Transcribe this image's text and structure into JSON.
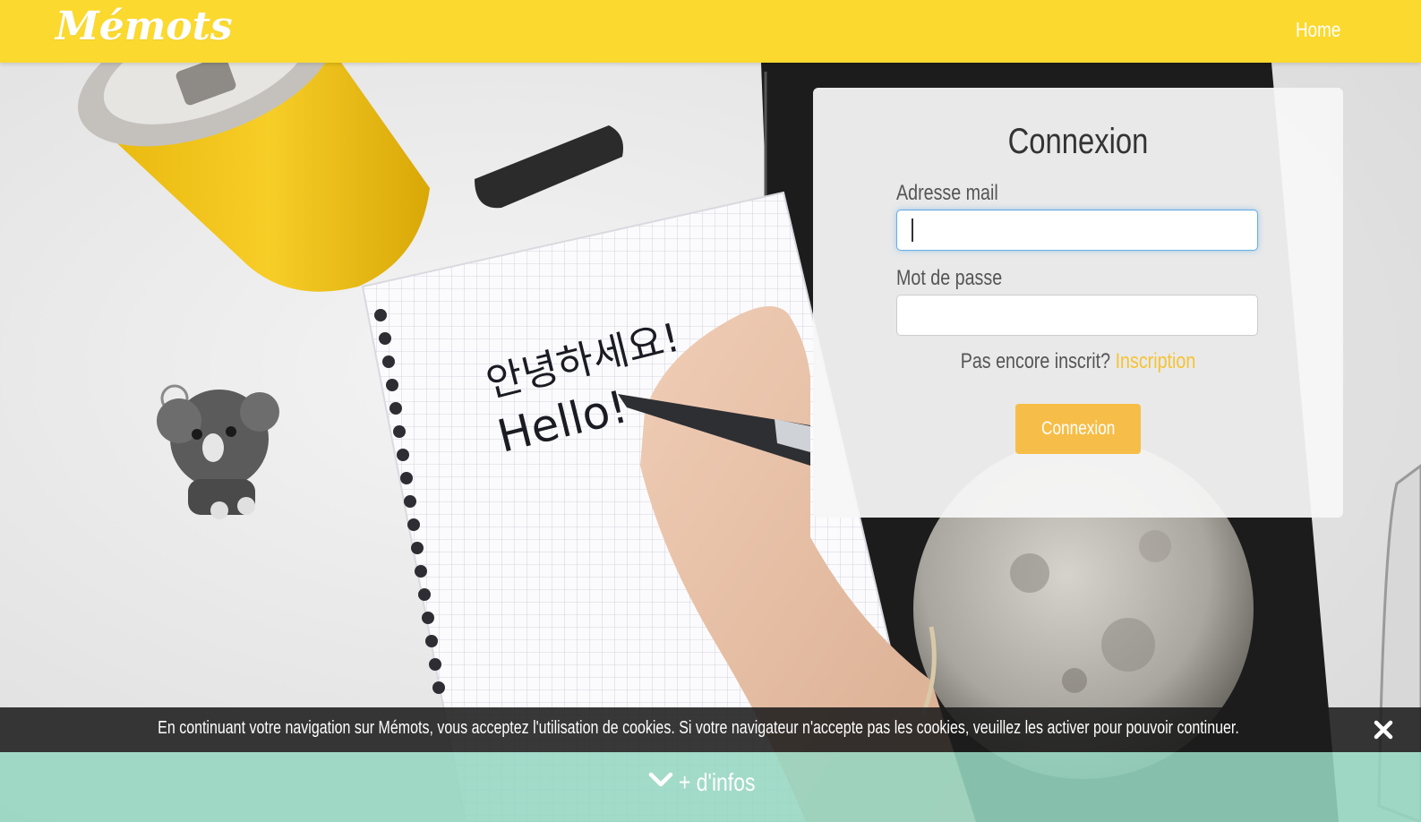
{
  "navbar": {
    "brand": "Mémots",
    "home_label": "Home",
    "background_color": "#fbd92e"
  },
  "login": {
    "title": "Connexion",
    "email_label": "Adresse mail",
    "email_value": "",
    "password_label": "Mot de passe",
    "password_value": "",
    "signup_prompt": "Pas encore inscrit?",
    "signup_link": "Inscription",
    "submit_label": "Connexion",
    "accent_color": "#f6be48"
  },
  "cookie_banner": {
    "text": "En continuant votre navigation sur Mémots, vous acceptez l'utilisation de cookies. Si votre navigateur n'accepte pas les cookies, veuillez les activer pour pouvoir continuer.",
    "close_icon": "close-icon"
  },
  "more_info": {
    "label": "+ d'infos",
    "icon": "chevron-down-icon",
    "background_color": "#96d6c1"
  },
  "background": {
    "handwriting_line1": "안녕하세요!",
    "handwriting_line2": "Hello!"
  }
}
